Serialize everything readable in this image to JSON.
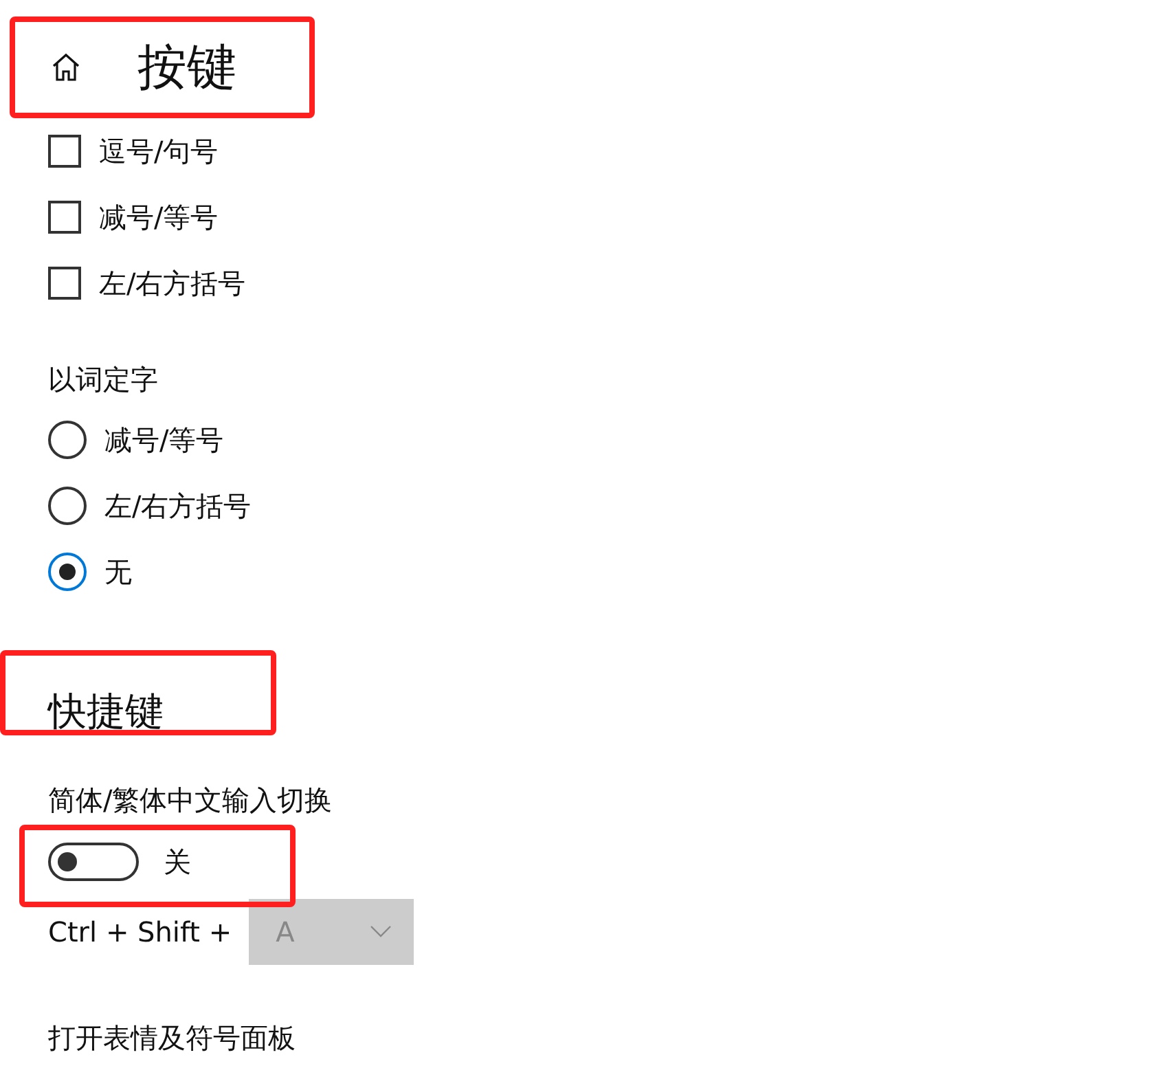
{
  "header": {
    "title": "按键",
    "highlighted": true
  },
  "checkboxes": [
    {
      "label": "逗号/句号",
      "checked": false
    },
    {
      "label": "减号/等号",
      "checked": false
    },
    {
      "label": "左/右方括号",
      "checked": false
    }
  ],
  "word_select": {
    "title": "以词定字",
    "options": [
      {
        "label": "减号/等号",
        "selected": false
      },
      {
        "label": "左/右方括号",
        "selected": false
      },
      {
        "label": "无",
        "selected": true
      }
    ]
  },
  "shortcuts": {
    "title": "快捷键",
    "highlighted": true,
    "toggle": {
      "label": "简体/繁体中文输入切换",
      "on": false,
      "state_text": "关",
      "highlighted": true
    },
    "combo": {
      "prefix": "Ctrl + Shift +",
      "value": "A",
      "disabled": true
    },
    "next_label": "打开表情及符号面板"
  }
}
